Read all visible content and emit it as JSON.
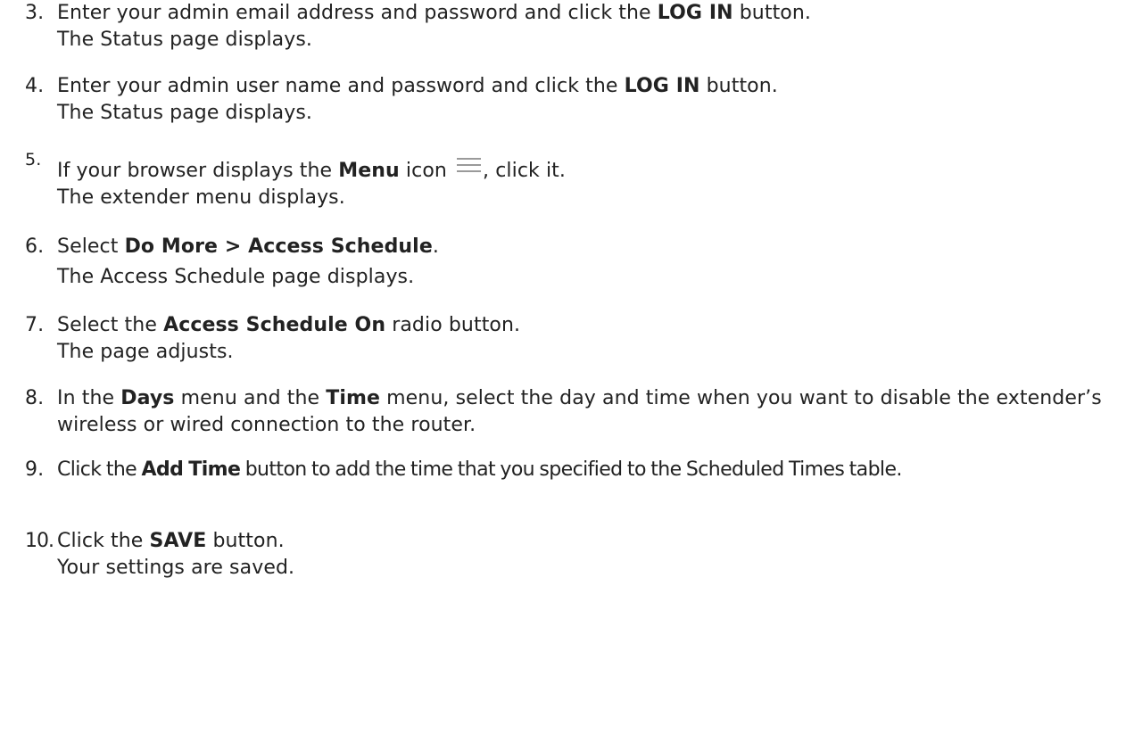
{
  "steps": [
    {
      "number": "3.",
      "t1": "Enter your admin email address and password and click the ",
      "b1": "LOG IN",
      "t2": " button.",
      "result": "The Status page displays."
    },
    {
      "number": "4.",
      "t1": "Enter your admin user name and password and click the ",
      "b1": "LOG IN",
      "t2": " button.",
      "result": "The Status page displays."
    },
    {
      "number": "5.",
      "t1": "If your browser displays the ",
      "b1": "Menu",
      "t2": " icon ",
      "icon": "hamburger-menu-icon",
      "t3": ", click it.",
      "result": "The extender menu displays."
    },
    {
      "number": "6.",
      "t1": "Select ",
      "b1": "Do More > Access Schedule",
      "t2": ".",
      "result": "The Access Schedule page displays."
    },
    {
      "number": "7.",
      "t1": "Select the ",
      "b1": "Access Schedule On",
      "t2": " radio button.",
      "result": "The page adjusts."
    },
    {
      "number": "8.",
      "t1": "In the ",
      "b1": "Days",
      "t2": " menu and the ",
      "b2": "Time",
      "t3": " menu, select the day and time when you want to disable the extender’s wireless or wired connection to the router."
    },
    {
      "number": "9.",
      "t1": "Click the ",
      "b1": "Add Time",
      "t2": " button to add the time that you specified to the Scheduled Times table."
    },
    {
      "number": "10.",
      "t1": "Click the ",
      "b1": "SAVE",
      "t2": " button.",
      "result": "Your settings are saved."
    }
  ],
  "colors": {
    "text": "#222222",
    "icon": "#9a9a9a"
  }
}
